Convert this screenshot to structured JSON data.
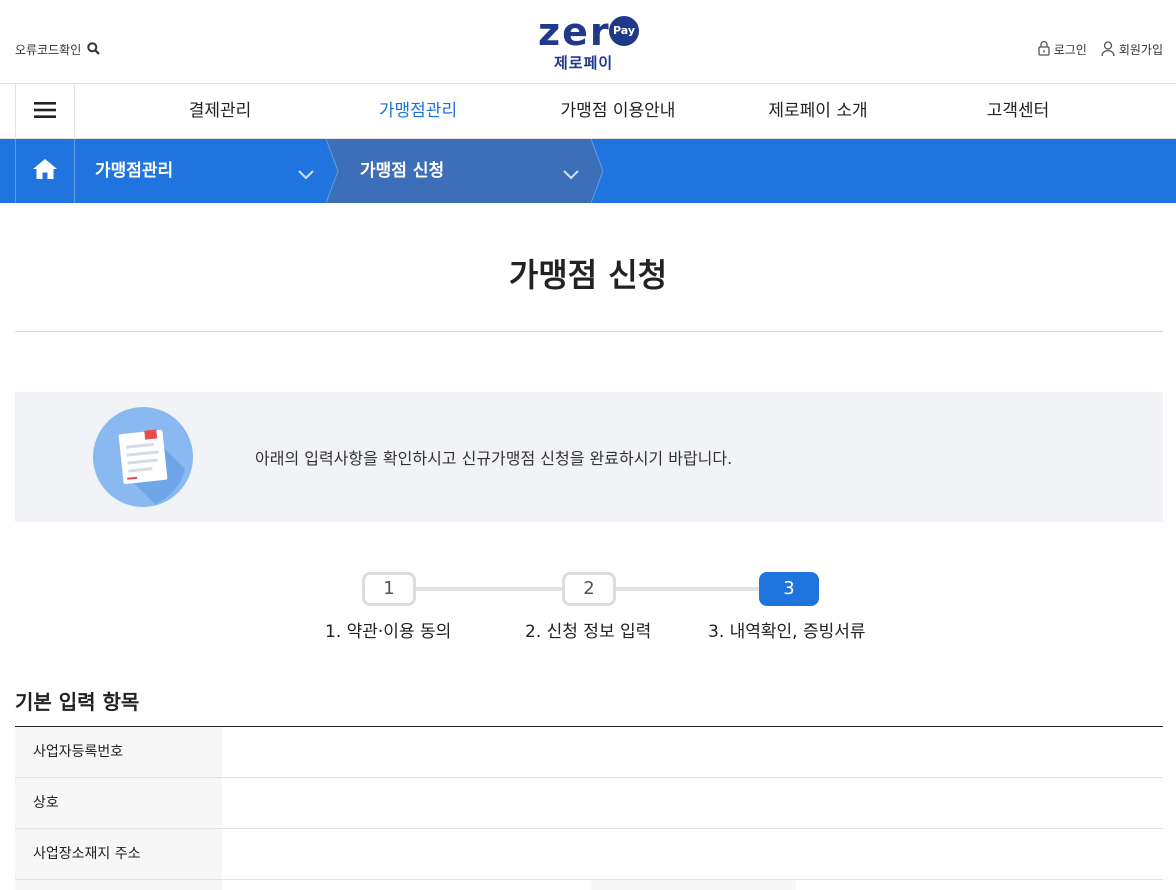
{
  "header": {
    "error_code_label": "오류코드확인",
    "logo_text": "zero",
    "logo_badge": "Pay",
    "logo_sub": "제로페이",
    "login_label": "로그인",
    "signup_label": "회원가입"
  },
  "gnb": {
    "items": [
      {
        "label": "결제관리"
      },
      {
        "label": "가맹점관리"
      },
      {
        "label": "가맹점 이용안내"
      },
      {
        "label": "제로페이 소개"
      },
      {
        "label": "고객센터"
      }
    ],
    "active_index": 1
  },
  "breadcrumb": {
    "items": [
      {
        "label": "가맹점관리"
      },
      {
        "label": "가맹점 신청"
      }
    ]
  },
  "page": {
    "title": "가맹점 신청",
    "notice": "아래의 입력사항을 확인하시고 신규가맹점 신청을 완료하시기 바랍니다."
  },
  "steps": {
    "items": [
      {
        "number": "1",
        "label": "1. 약관·이용 동의"
      },
      {
        "number": "2",
        "label": "2. 신청 정보 입력"
      },
      {
        "number": "3",
        "label": "3. 내역확인, 증빙서류"
      }
    ],
    "current": 3
  },
  "form": {
    "section_title": "기본 입력 항목",
    "rows": [
      {
        "label": "사업자등록번호",
        "value": ""
      },
      {
        "label": "상호",
        "value": ""
      },
      {
        "label": "사업장소재지 주소",
        "value": ""
      }
    ]
  },
  "colors": {
    "brand_navy": "#1f3a8a",
    "accent_blue": "#1f74e0",
    "active_text": "#1a73d9"
  }
}
